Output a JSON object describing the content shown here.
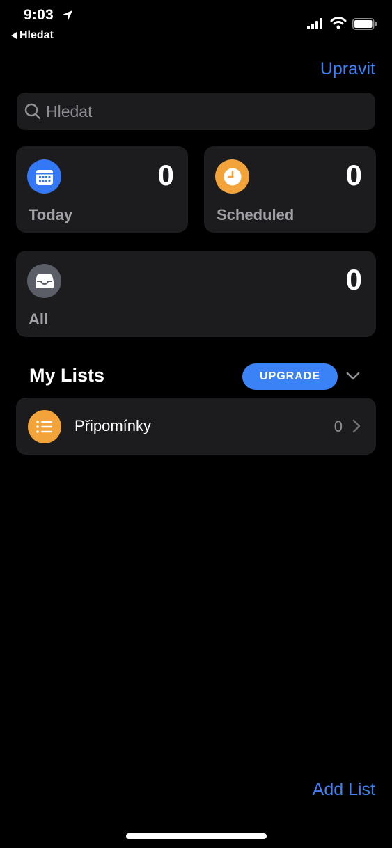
{
  "status_bar": {
    "time": "9:03",
    "back_label": "Hledat"
  },
  "header": {
    "edit_label": "Upravit"
  },
  "search": {
    "placeholder": "Hledat"
  },
  "smart_lists": [
    {
      "label": "Today",
      "count": "0",
      "icon": "calendar-icon",
      "color": "#3478f6"
    },
    {
      "label": "Scheduled",
      "count": "0",
      "icon": "clock-icon",
      "color": "#f2a33a"
    },
    {
      "label": "All",
      "count": "0",
      "icon": "tray-icon",
      "color": "#5b5e66"
    }
  ],
  "my_lists": {
    "title": "My Lists",
    "upgrade_label": "UPGRADE",
    "items": [
      {
        "name": "Připomínky",
        "count": "0",
        "icon": "list-bullet-icon",
        "color": "#f2a33a"
      }
    ]
  },
  "footer": {
    "add_list_label": "Add List"
  },
  "colors": {
    "accent": "#3b82f6",
    "card_bg": "#1c1c1e",
    "background": "#000000"
  }
}
